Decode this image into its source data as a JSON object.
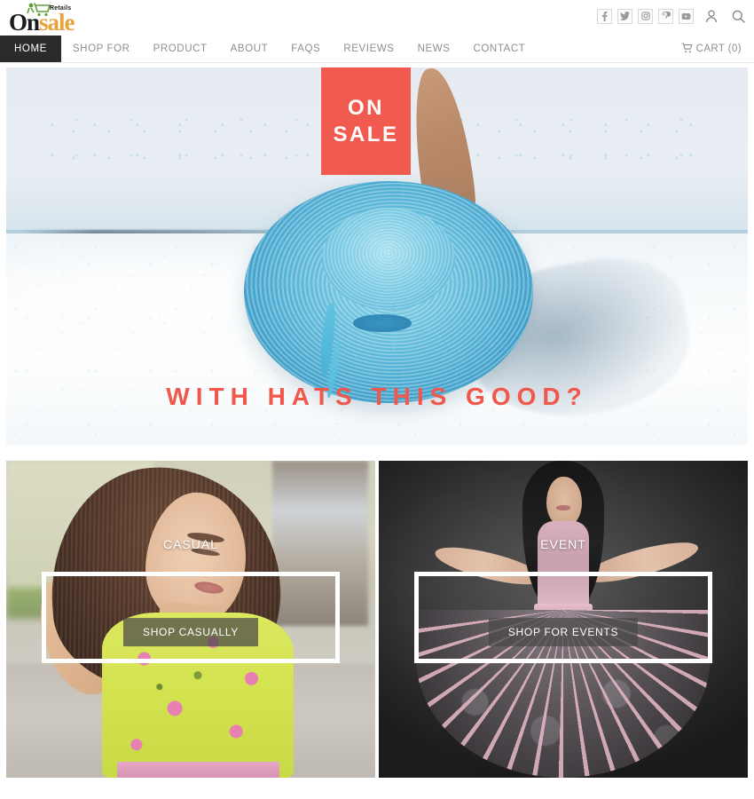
{
  "brand": {
    "cart_icon": "shopping-cart-icon",
    "tagline_small": "Retails",
    "name_part1": "On",
    "name_part2": "sale"
  },
  "header": {
    "social": [
      {
        "name": "facebook-icon",
        "glyph": "f"
      },
      {
        "name": "twitter-icon",
        "glyph": "t"
      },
      {
        "name": "instagram-icon",
        "glyph": "i"
      },
      {
        "name": "pinterest-icon",
        "glyph": "p"
      },
      {
        "name": "youtube-icon",
        "glyph": "y"
      }
    ],
    "account_icon": "user-icon",
    "search_icon": "search-icon"
  },
  "nav": {
    "items": [
      {
        "label": "HOME",
        "active": true
      },
      {
        "label": "SHOP FOR",
        "active": false
      },
      {
        "label": "PRODUCT",
        "active": false
      },
      {
        "label": "ABOUT",
        "active": false
      },
      {
        "label": "FAQS",
        "active": false
      },
      {
        "label": "REVIEWS",
        "active": false
      },
      {
        "label": "NEWS",
        "active": false
      },
      {
        "label": "CONTACT",
        "active": false
      }
    ],
    "cart_label": "CART (0)",
    "cart_icon": "cart-icon"
  },
  "hero": {
    "badge_line1": "ON",
    "badge_line2": "SALE",
    "badge_color": "#f05a4f",
    "tagline": "WITH  HATS THIS  GOOD?",
    "tagline_color": "#f0584c",
    "image_alt": "blue straw sun hat on white sand beach"
  },
  "promos": [
    {
      "heading": "CASUAL",
      "button": "SHOP CASUALLY",
      "image_alt": "woman in yellow floral dress outdoors"
    },
    {
      "heading": "EVENT",
      "button": "SHOP FOR EVENTS",
      "image_alt": "woman in pink rose patterned flared dress on dark backdrop"
    }
  ]
}
